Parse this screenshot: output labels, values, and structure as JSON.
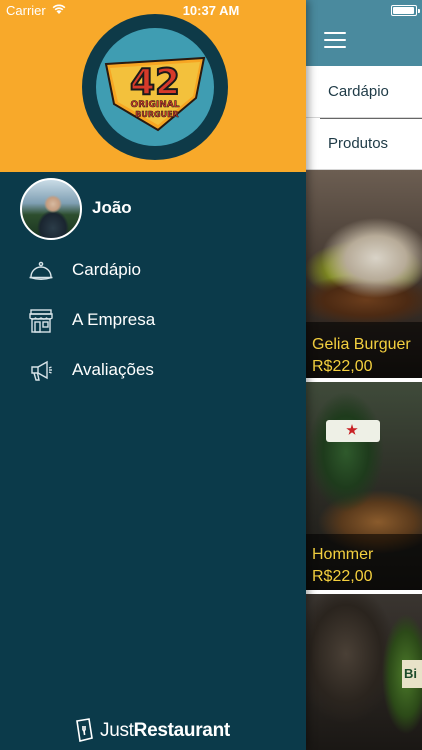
{
  "status_bar": {
    "carrier": "Carrier",
    "time": "10:37 AM"
  },
  "logo": {
    "number": "42",
    "line1": "ORIGINAL",
    "line2": "BURGUER"
  },
  "user": {
    "name": "João"
  },
  "menu": {
    "items": [
      {
        "label": "Cardápio",
        "icon": "cloche-icon"
      },
      {
        "label": "A Empresa",
        "icon": "storefront-icon"
      },
      {
        "label": "Avaliações",
        "icon": "megaphone-icon"
      }
    ]
  },
  "footer": {
    "brand_light": "Just",
    "brand_bold": "Restaurant"
  },
  "tabs": [
    {
      "label": "Cardápio"
    },
    {
      "label": "Produtos"
    }
  ],
  "products": [
    {
      "name": "Gelia Burguer",
      "price": "R$22,00"
    },
    {
      "name": "Hommer",
      "price": "R$22,00"
    }
  ],
  "colors": {
    "header_orange": "#f8a92a",
    "drawer_bg": "#0b3a4a",
    "top_bar": "#4a8a9e",
    "price_yellow": "#f4d03f"
  }
}
